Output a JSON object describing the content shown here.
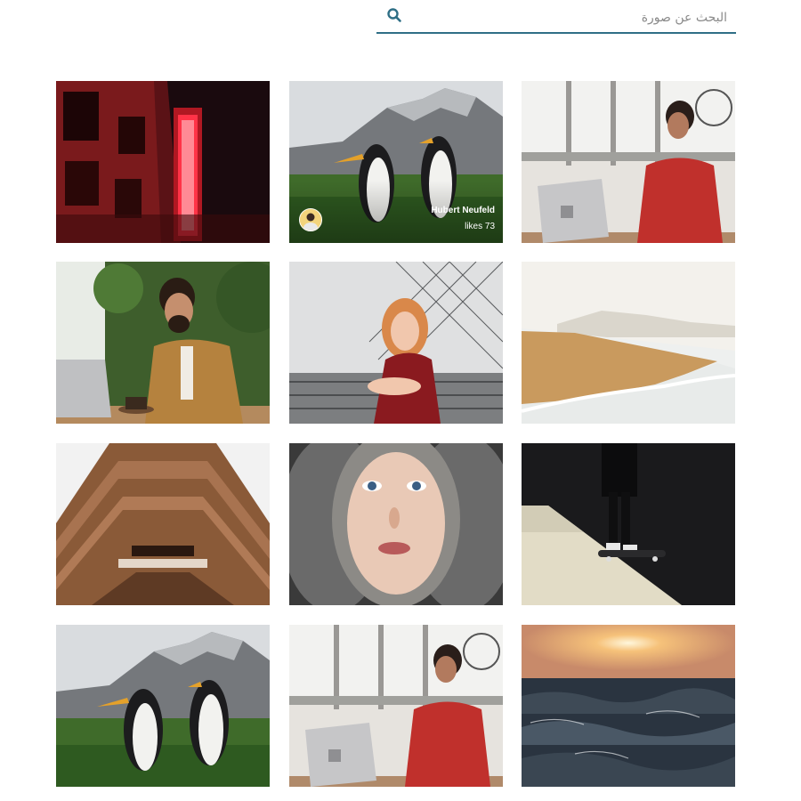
{
  "search": {
    "placeholder": "البحث عن صورة",
    "value": "",
    "icon": "search-icon",
    "underline_color": "#2f6f86"
  },
  "gallery": {
    "photos": [
      {
        "subject": "neon-hotel-sign"
      },
      {
        "subject": "penguins-mountains",
        "author": "Hubert Neufeld",
        "likes_label": "likes 73",
        "likes": 73
      },
      {
        "subject": "woman-laptop-red-sweater"
      },
      {
        "subject": "man-laptop-coffee"
      },
      {
        "subject": "redhead-woman-net-fence"
      },
      {
        "subject": "misty-beach"
      },
      {
        "subject": "brick-building-from-below"
      },
      {
        "subject": "freckled-face-portrait"
      },
      {
        "subject": "skateboarder-shadow"
      },
      {
        "subject": "penguins-mountains"
      },
      {
        "subject": "woman-laptop-red-sweater"
      },
      {
        "subject": "ocean-sunset"
      }
    ]
  }
}
